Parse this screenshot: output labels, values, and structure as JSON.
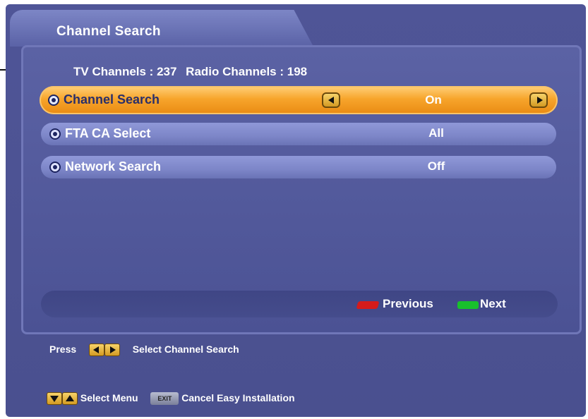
{
  "tab": {
    "title": "Channel Search"
  },
  "counts": {
    "tv": "TV Channels : 237",
    "radio": "Radio Channels : 198"
  },
  "menu": [
    {
      "label": "Channel Search",
      "value": "On",
      "selected": true
    },
    {
      "label": "FTA CA Select",
      "value": "All",
      "selected": false
    },
    {
      "label": "Network Search",
      "value": "Off",
      "selected": false
    }
  ],
  "navbar": {
    "previous": "Previous",
    "next": "Next"
  },
  "help": {
    "press": "Press",
    "select_channel_search": "Select Channel Search",
    "select_menu": "Select Menu",
    "exit_key": "EXIT",
    "cancel": "Cancel Easy Installation"
  },
  "colors": {
    "highlight": "#f7a52c",
    "panel": "#5b62a4",
    "red_key": "#d51b1b",
    "green_key": "#18c02c"
  }
}
